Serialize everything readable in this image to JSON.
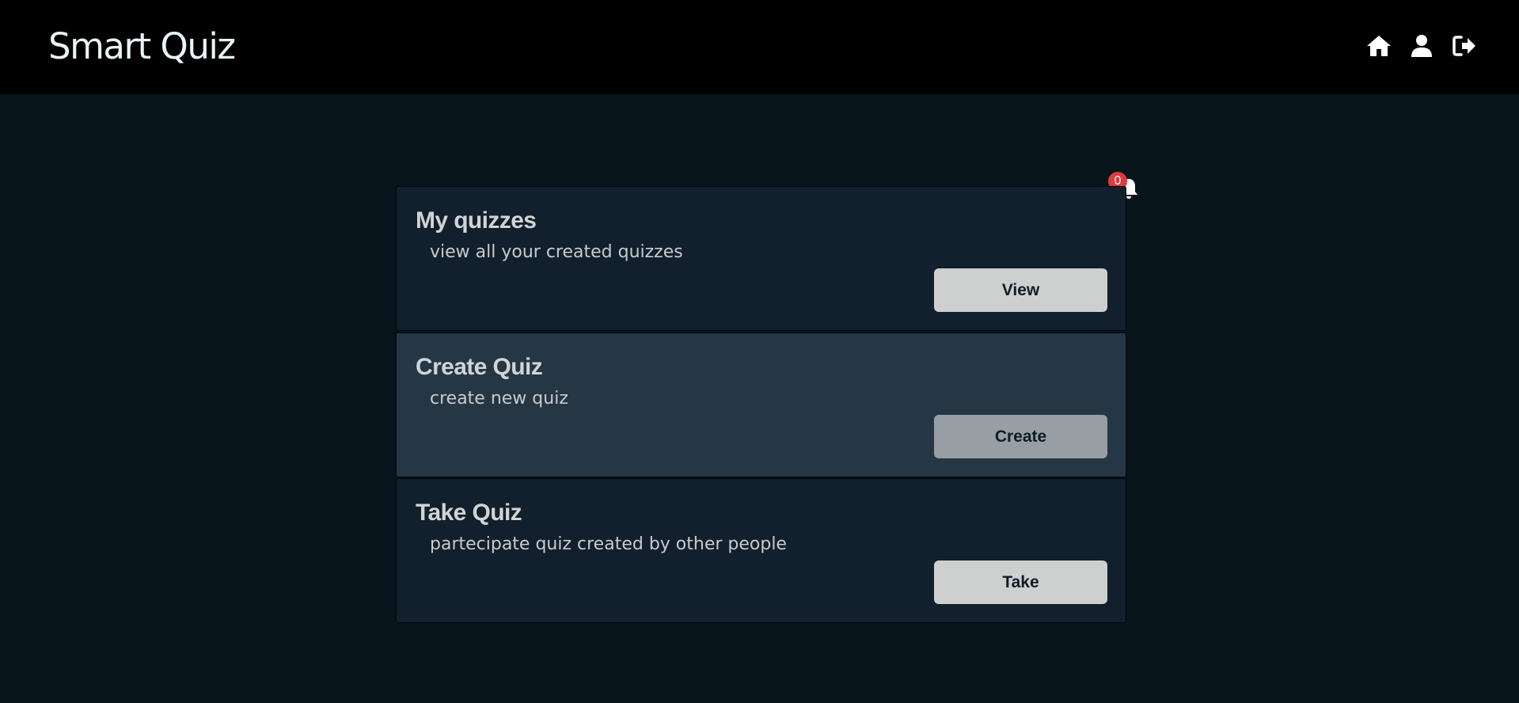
{
  "header": {
    "brand": "Smart Quiz",
    "nav": [
      {
        "icon": "home-icon"
      },
      {
        "icon": "user-icon"
      },
      {
        "icon": "logout-icon"
      }
    ]
  },
  "notifications": {
    "icon": "bell-icon",
    "count": "0",
    "badge_color": "#e03a3e"
  },
  "cards": [
    {
      "title": "My quizzes",
      "description": "view all your created quizzes",
      "button": "View"
    },
    {
      "title": "Create Quiz",
      "description": "create new quiz",
      "button": "Create"
    },
    {
      "title": "Take Quiz",
      "description": "partecipate quiz created by other people",
      "button": "Take"
    }
  ],
  "colors": {
    "background": "#07141b",
    "topbar": "#000000",
    "card_dark": "#121f2c",
    "card_highlight": "#253645",
    "button": "#cdd0cf",
    "button_muted": "#979fa5"
  }
}
